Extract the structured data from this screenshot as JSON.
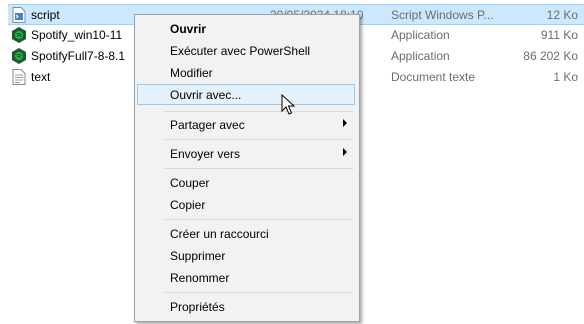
{
  "files": [
    {
      "name": "script",
      "date": "30/05/2024 18:10",
      "type": "Script Windows P...",
      "size": "12 Ko",
      "icon": "script-file-icon",
      "selected": true
    },
    {
      "name": "Spotify_win10-11",
      "date": "",
      "type": "Application",
      "size": "911 Ko",
      "icon": "spotify-app-icon"
    },
    {
      "name": "SpotifyFull7-8-8.1",
      "date": "",
      "type": "Application",
      "size": "86 202 Ko",
      "icon": "spotify-app-icon"
    },
    {
      "name": "text",
      "date": "",
      "type": "Document texte",
      "size": "1 Ko",
      "icon": "text-file-icon"
    }
  ],
  "context_menu": {
    "open": "Ouvrir",
    "run_powershell": "Exécuter avec PowerShell",
    "edit": "Modifier",
    "open_with": "Ouvrir avec...",
    "share_with": "Partager avec",
    "send_to": "Envoyer vers",
    "cut": "Couper",
    "copy": "Copier",
    "create_shortcut": "Créer un raccourci",
    "delete": "Supprimer",
    "rename": "Renommer",
    "properties": "Propriétés"
  },
  "colors": {
    "selection": "#cce8ff",
    "menu_bg": "#f2f2f2",
    "menu_hover": "#e5f1fb"
  }
}
